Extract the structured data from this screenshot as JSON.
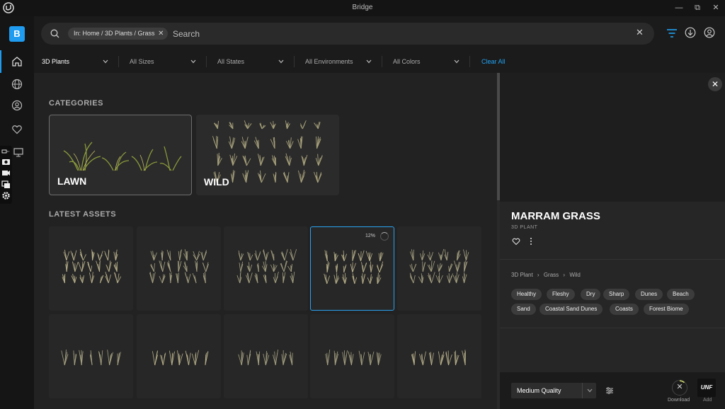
{
  "window": {
    "title": "Bridge"
  },
  "search": {
    "chip_label": "In: Home / 3D Plants / Grass",
    "placeholder": "Search"
  },
  "filters": [
    {
      "label": "3D Plants"
    },
    {
      "label": "All Sizes"
    },
    {
      "label": "All States"
    },
    {
      "label": "All Environments"
    },
    {
      "label": "All Colors"
    }
  ],
  "clear_all": "Clear All",
  "sections": {
    "categories": "CATEGORIES",
    "latest": "LATEST ASSETS"
  },
  "categories": [
    {
      "label": "LAWN",
      "selected": true
    },
    {
      "label": "WILD",
      "selected": false
    }
  ],
  "tiles": [
    {
      "selected": false
    },
    {
      "selected": false
    },
    {
      "selected": false
    },
    {
      "selected": true,
      "progress_label": "12%"
    },
    {
      "selected": false
    },
    {
      "selected": false
    },
    {
      "selected": false
    },
    {
      "selected": false
    },
    {
      "selected": false
    },
    {
      "selected": false
    }
  ],
  "panel": {
    "asset_name": "MARRAM GRASS",
    "asset_type": "3D PLANT",
    "breadcrumb": [
      "3D Plant",
      "Grass",
      "Wild"
    ],
    "tags": [
      "Healthy",
      "Fleshy",
      "Dry",
      "Sharp",
      "Dunes",
      "Beach",
      "Sand",
      "Coastal Sand Dunes",
      "Coasts",
      "Forest Biome"
    ]
  },
  "bottom": {
    "quality": "Medium Quality",
    "download_label": "Download",
    "add_label": "Add",
    "add_logo": "UNF"
  },
  "icons": {
    "nav": [
      "home-icon",
      "globe-icon",
      "user-icon",
      "heart-icon",
      "monitor-icon"
    ],
    "toolbar": [
      "filter-icon",
      "download-icon",
      "account-icon"
    ]
  },
  "colors": {
    "accent": "#1f9cf0",
    "bg": "#1b1b1b",
    "panel": "#262626"
  }
}
